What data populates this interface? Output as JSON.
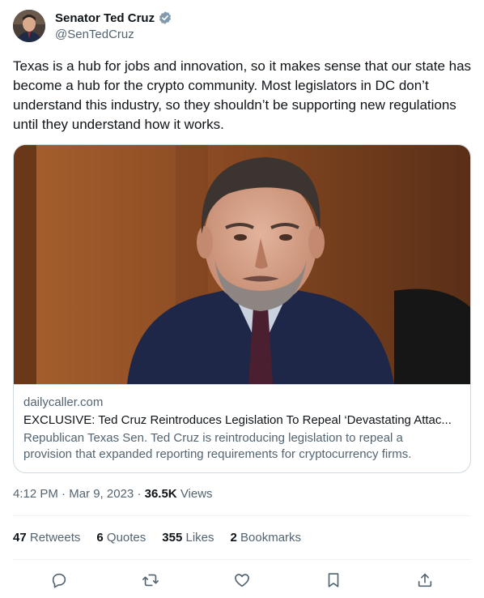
{
  "author": {
    "display_name": "Senator Ted Cruz",
    "handle": "@SenTedCruz",
    "verified_icon": "verified-badge-icon"
  },
  "tweet": {
    "text": "Texas is a hub for jobs and innovation, so it makes sense that our state has become a hub for the crypto community. Most legislators in DC don’t understand this industry, so they shouldn’t be supporting new regulations until they understand how it works."
  },
  "card": {
    "domain": "dailycaller.com",
    "title": "EXCLUSIVE: Ted Cruz Reintroduces Legislation To Repeal ‘Devastating Attac...",
    "description": "Republican Texas Sen. Ted Cruz is reintroducing legislation to repeal a provision that expanded reporting requirements for cryptocurrency firms."
  },
  "meta": {
    "time": "4:12 PM",
    "separator": "·",
    "date": "Mar 9, 2023",
    "views_count": "36.5K",
    "views_label": "Views"
  },
  "stats": {
    "retweets_count": "47",
    "retweets_label": "Retweets",
    "quotes_count": "6",
    "quotes_label": "Quotes",
    "likes_count": "355",
    "likes_label": "Likes",
    "bookmarks_count": "2",
    "bookmarks_label": "Bookmarks"
  },
  "actions": [
    "reply-icon",
    "retweet-icon",
    "like-icon",
    "bookmark-icon",
    "share-icon"
  ],
  "colors": {
    "text_primary": "#0f1419",
    "text_secondary": "#536471",
    "verified": "#829aab",
    "border": "#cfd9de"
  }
}
